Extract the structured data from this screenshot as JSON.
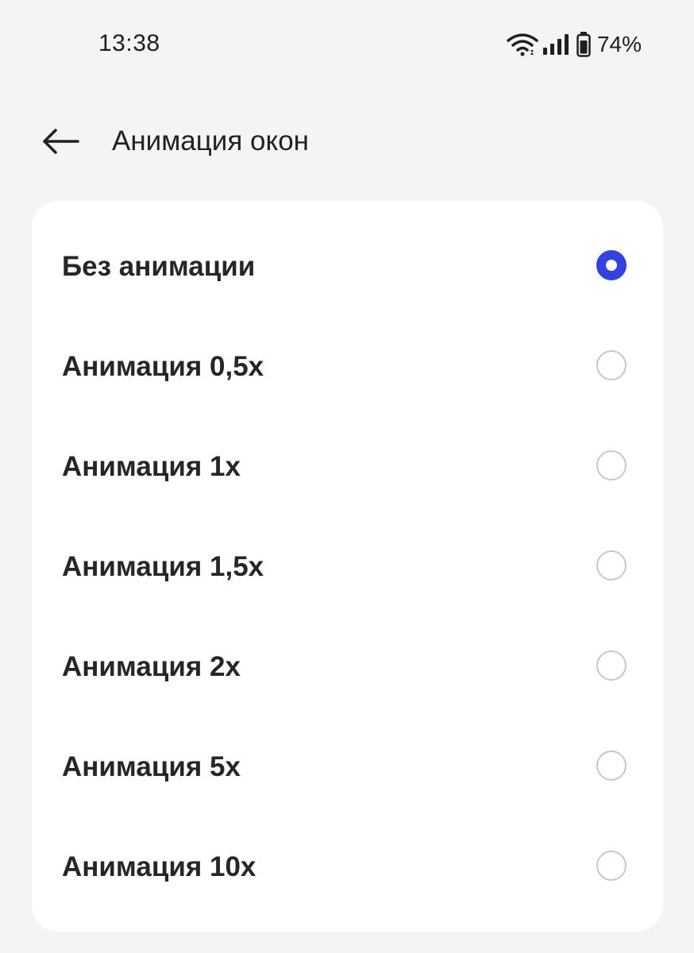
{
  "status_bar": {
    "time": "13:38",
    "battery_percent": "74%",
    "icons": [
      "wifi-icon",
      "cellular-signal-icon",
      "battery-icon"
    ]
  },
  "header": {
    "back_icon": "arrow-left-icon",
    "title": "Анимация окон"
  },
  "options": [
    {
      "label": "Без анимации",
      "selected": true
    },
    {
      "label": "Анимация 0,5x",
      "selected": false
    },
    {
      "label": "Анимация 1x",
      "selected": false
    },
    {
      "label": "Анимация 1,5x",
      "selected": false
    },
    {
      "label": "Анимация 2x",
      "selected": false
    },
    {
      "label": "Анимация 5x",
      "selected": false
    },
    {
      "label": "Анимация 10x",
      "selected": false
    }
  ],
  "colors": {
    "accent": "#3341e0",
    "background": "#f4f4f4",
    "card": "#ffffff",
    "radio_border": "#c8c8c8"
  }
}
